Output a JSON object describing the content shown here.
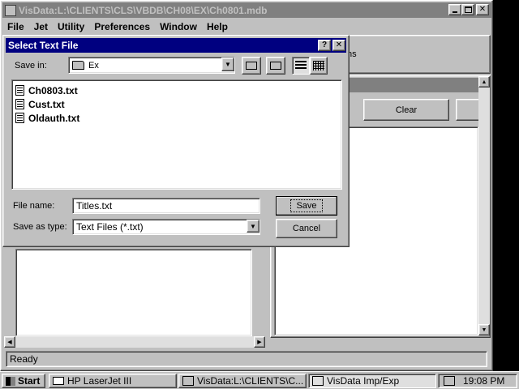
{
  "main_window": {
    "title": "VisData:L:\\CLIENTS\\CLS\\VBDB\\CH08\\EX\\Ch0801.mdb",
    "menu": [
      "File",
      "Jet",
      "Utility",
      "Preferences",
      "Window",
      "Help"
    ],
    "partial_button": "ns",
    "clear_button": "Clear",
    "status_text": "Ready"
  },
  "dialog": {
    "title": "Select Text File",
    "save_in_label": "Save in:",
    "save_in_value": "Ex",
    "files": [
      "Ch0803.txt",
      "Cust.txt",
      "Oldauth.txt"
    ],
    "file_name_label": "File name:",
    "file_name_value": "Titles.txt",
    "save_as_type_label": "Save as type:",
    "save_as_type_value": "Text Files (*.txt)",
    "save_button": "Save",
    "cancel_button": "Cancel"
  },
  "taskbar": {
    "start_label": "Start",
    "tasks": [
      "HP LaserJet III",
      "VisData:L:\\CLIENTS\\C...",
      "VisData Imp/Exp"
    ],
    "clock": "19:08 PM"
  }
}
